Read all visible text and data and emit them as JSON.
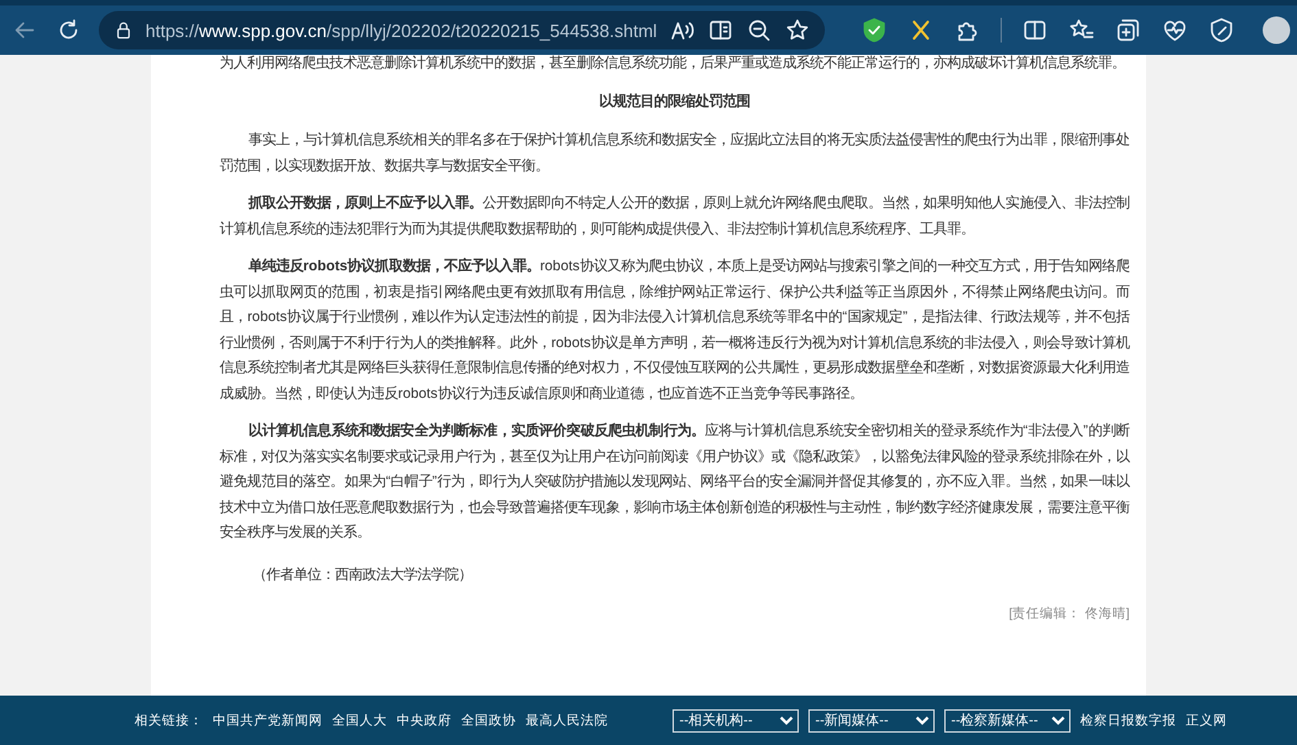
{
  "browser": {
    "url": "https://**www.spp.gov.cn**/spp/llyj/202202/t20220215_544538.shtml"
  },
  "article": {
    "blocks": [
      {
        "kind": "continuation",
        "text": "为人利用网络爬虫技术恶意删除计算机系统中的数据，甚至删除信息系统功能，后果严重或造成系统不能正常运行的，亦构成破坏计算机信息系统罪。"
      },
      {
        "kind": "heading",
        "text": "以规范目的限缩处罚范围"
      },
      {
        "kind": "body",
        "text": "事实上，与计算机信息系统相关的罪名多在于保护计算机信息系统和数据安全，应据此立法目的将无实质法益侵害性的爬虫行为出罪，限缩刑事处罚范围，以实现数据开放、数据共享与数据安全平衡。"
      },
      {
        "kind": "body",
        "text": "**抓取公开数据，原则上不应予以入罪。**公开数据即向不特定人公开的数据，原则上就允许网络爬虫爬取。当然，如果明知他人实施侵入、非法控制计算机信息系统的违法犯罪行为而为其提供爬取数据帮助的，则可能构成提供侵入、非法控制计算机信息系统程序、工具罪。"
      },
      {
        "kind": "body",
        "text": "**单纯违反robots协议抓取数据，不应予以入罪。**robots协议又称为爬虫协议，本质上是受访网站与搜索引擎之间的一种交互方式，用于告知网络爬虫可以抓取网页的范围，初衷是指引网络爬虫更有效抓取有用信息，除维护网站正常运行、保护公共利益等正当原因外，不得禁止网络爬虫访问。而且，robots协议属于行业惯例，难以作为认定违法性的前提，因为非法侵入计算机信息系统等罪名中的“国家规定”，是指法律、行政法规等，并不包括行业惯例，否则属于不利于行为人的类推解释。此外，robots协议是单方声明，若一概将违反行为视为对计算机信息系统的非法侵入，则会导致计算机信息系统控制者尤其是网络巨头获得任意限制信息传播的绝对权力，不仅侵蚀互联网的公共属性，更易形成数据壁垒和垄断，对数据资源最大化利用造成威胁。当然，即使认为违反robots协议行为违反诚信原则和商业道德，也应首选不正当竞争等民事路径。"
      },
      {
        "kind": "body",
        "text": "**以计算机信息系统和数据安全为判断标准，实质评价突破反爬虫机制行为。**应将与计算机信息系统安全密切相关的登录系统作为“非法侵入”的判断标准，对仅为落实实名制要求或记录用户行为，甚至仅为让用户在访问前阅读《用户协议》或《隐私政策》，以豁免法律风险的登录系统排除在外，以避免规范目的落空。如果为“白帽子”行为，即行为人突破防护措施以发现网站、网络平台的安全漏洞并督促其修复的，亦不应入罪。当然，如果一味以技术中立为借口放任恶意爬取数据行为，也会导致普遍搭便车现象，影响市场主体创新创造的积极性与主动性，制约数字经济健康发展，需要注意平衡安全秩序与发展的关系。"
      },
      {
        "kind": "byline",
        "text": "（作者单位：西南政法大学法学院）"
      },
      {
        "kind": "editor",
        "text": "[责任编辑： 佟海晴]"
      }
    ]
  },
  "footer": {
    "label": "相关链接：",
    "links": [
      "中国共产党新闻网",
      "全国人大",
      "中央政府",
      "全国政协",
      "最高人民法院"
    ],
    "selects": [
      "--相关机构--",
      "--新闻媒体--",
      "--检察新媒体--"
    ],
    "more_links": [
      "检察日报数字报",
      "正义网"
    ]
  }
}
